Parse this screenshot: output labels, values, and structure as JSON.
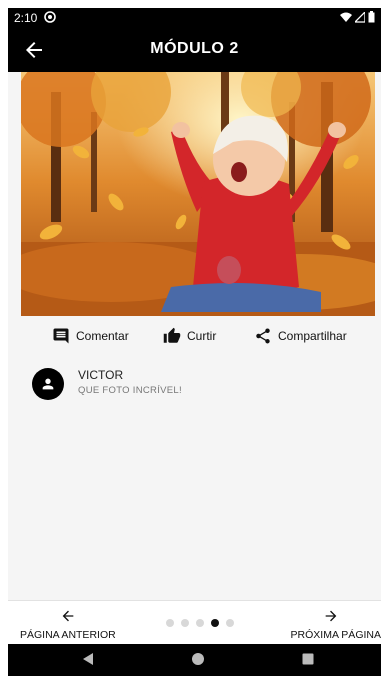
{
  "status_bar": {
    "time": "2:10"
  },
  "app_bar": {
    "title": "MÓDULO 2"
  },
  "actions": {
    "comment_label": "Comentar",
    "like_label": "Curtir",
    "share_label": "Compartilhar"
  },
  "comment": {
    "author": "VICTOR",
    "text": "QUE FOTO INCRÍVEL!"
  },
  "pagination": {
    "total_pages": 5,
    "current_page": 4
  },
  "bottom_nav": {
    "prev_label": "PÁGINA ANTERIOR",
    "next_label": "PRÓXIMA PÁGINA"
  },
  "colors": {
    "app_bar": "#000000",
    "background": "#f5f5f5",
    "active_dot": "#111111",
    "inactive_dot": "#d8d8d8"
  }
}
